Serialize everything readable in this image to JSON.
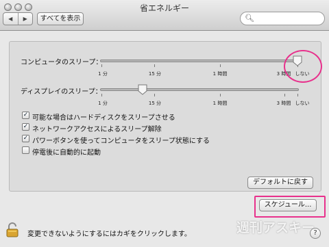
{
  "window": {
    "title": "省エネルギー"
  },
  "toolbar": {
    "back_icon": "◀",
    "forward_icon": "▶",
    "show_all_label": "すべてを表示",
    "search_placeholder": ""
  },
  "sleep": {
    "computer_label": "コンピュータのスリープ：",
    "display_label": "ディスプレイのスリープ：",
    "ticks": [
      "1 分",
      "15 分",
      "1 時間",
      "3 時間",
      "しない"
    ],
    "computer_value": "しない",
    "display_value": "15 分"
  },
  "options": [
    {
      "label": "可能な場合はハードディスクをスリープさせる",
      "checked": true
    },
    {
      "label": "ネットワークアクセスによるスリープ解除",
      "checked": true
    },
    {
      "label": "パワーボタンを使ってコンピュータをスリープ状態にする",
      "checked": true
    },
    {
      "label": "停電後に自動的に起動",
      "checked": false
    }
  ],
  "buttons": {
    "restore_defaults": "デフォルトに戻す",
    "schedule": "スケジュール..."
  },
  "lock": {
    "text": "変更できないようにするにはカギをクリックします。"
  },
  "help": {
    "label": "?"
  },
  "watermark": {
    "text": "週刊アスキー"
  },
  "colors": {
    "highlight": "#e8308c"
  }
}
